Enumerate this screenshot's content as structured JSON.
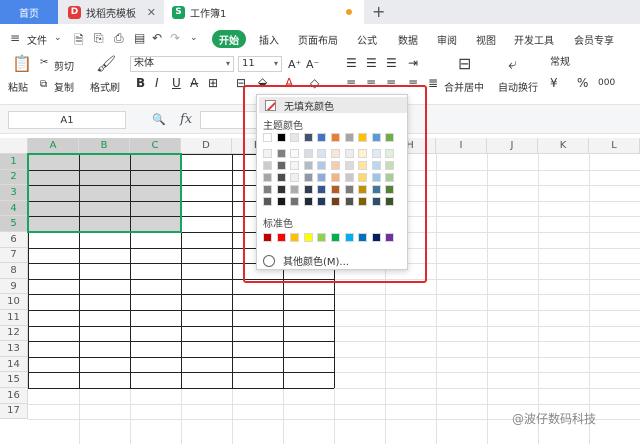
{
  "tabs": {
    "home": "首页",
    "template": "找稻壳模板",
    "workbook": "工作簿1"
  },
  "menu": {
    "file": "文件",
    "start": "开始",
    "items": [
      "插入",
      "页面布局",
      "公式",
      "数据",
      "审阅",
      "视图",
      "开发工具",
      "会员专享"
    ]
  },
  "ribbon": {
    "paste": "粘贴",
    "cut": "剪切",
    "copy": "复制",
    "format_painter": "格式刷",
    "font_name": "宋体",
    "font_size": "11",
    "bold": "B",
    "italic": "I",
    "underline": "U",
    "merge_center": "合并居中",
    "auto_wrap": "自动换行",
    "number_format": "常规",
    "currency": "¥",
    "percent": "%",
    "thousands": "000"
  },
  "formula": {
    "cell_ref": "A1",
    "fx": "fx"
  },
  "columns": [
    "A",
    "B",
    "C",
    "D",
    "E",
    "F",
    "G",
    "H",
    "I",
    "J",
    "K",
    "L"
  ],
  "rows": [
    "1",
    "2",
    "3",
    "4",
    "5",
    "6",
    "7",
    "8",
    "9",
    "10",
    "11",
    "12",
    "13",
    "14",
    "15",
    "16",
    "17"
  ],
  "fill_menu": {
    "no_fill": "无填充颜色",
    "theme_colors": "主题颜色",
    "standard_colors": "标准色",
    "more_colors": "其他颜色(M)...",
    "theme_top_row": [
      "#ffffff",
      "#000000",
      "#e7e6e6",
      "#44546a",
      "#4472c4",
      "#ed7d31",
      "#a5a5a5",
      "#ffc000",
      "#5b9bd5",
      "#70ad47"
    ],
    "standard_row": [
      "#c00000",
      "#ff0000",
      "#ffc000",
      "#ffff00",
      "#92d050",
      "#00b050",
      "#00b0f0",
      "#0070c0",
      "#002060",
      "#7030a0"
    ]
  },
  "accent_color": "#1aa260",
  "highlight_frame_color": "#e0292a",
  "watermark": "@波仔数码科技"
}
